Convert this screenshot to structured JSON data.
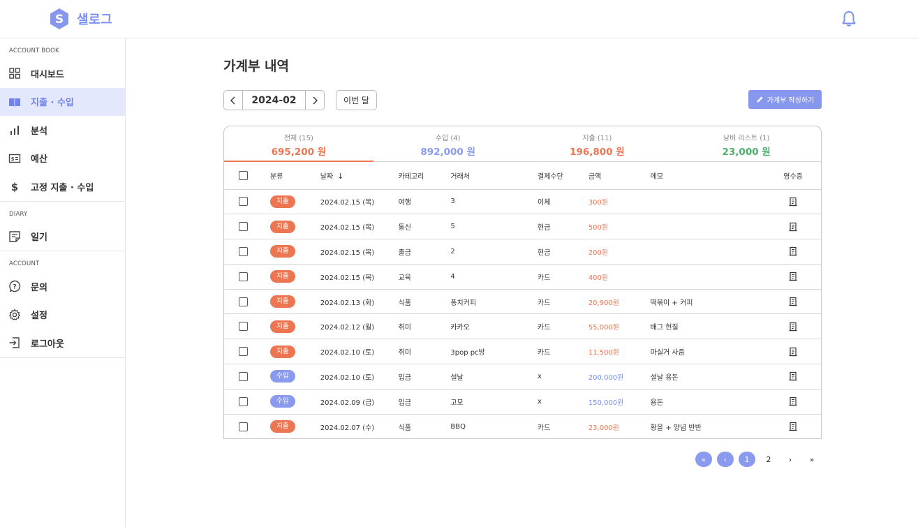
{
  "app": {
    "name": "샐로그",
    "logo_letter": "S"
  },
  "colors": {
    "accent": "#7b8ff0",
    "expense": "#ec7552",
    "income": "#8a9bef",
    "waste": "#4caf6a"
  },
  "sidebar": {
    "sections": [
      {
        "title": "ACCOUNT BOOK",
        "items": [
          {
            "label": "대시보드",
            "icon": "grid-icon"
          },
          {
            "label": "지출 · 수입",
            "icon": "book-icon",
            "active": true
          },
          {
            "label": "분석",
            "icon": "bar-chart-icon"
          },
          {
            "label": "예산",
            "icon": "wallet-icon"
          },
          {
            "label": "고정 지출 · 수입",
            "icon": "dollar-icon"
          }
        ]
      },
      {
        "title": "DIARY",
        "items": [
          {
            "label": "일기",
            "icon": "note-icon"
          }
        ]
      },
      {
        "title": "ACCOUNT",
        "items": [
          {
            "label": "문의",
            "icon": "question-icon"
          },
          {
            "label": "설정",
            "icon": "gear-icon"
          },
          {
            "label": "로그아웃",
            "icon": "logout-icon"
          }
        ]
      }
    ]
  },
  "main": {
    "title": "가계부 내역",
    "month": "2024-02",
    "this_month_label": "이번 달",
    "write_label": "가계부 작성하기",
    "summary": [
      {
        "label": "전체 (15)",
        "amount": "695,200 원",
        "color": "#ec7552",
        "active": true
      },
      {
        "label": "수입 (4)",
        "amount": "892,000 원",
        "color": "#8a9bef"
      },
      {
        "label": "지출 (11)",
        "amount": "196,800 원",
        "color": "#ec7552"
      },
      {
        "label": "낭비 리스트 (1)",
        "amount": "23,000 원",
        "color": "#4caf6a"
      }
    ],
    "columns": [
      "분류",
      "날짜",
      "카테고리",
      "거래처",
      "결제수단",
      "금액",
      "메모",
      "영수증"
    ],
    "rows": [
      {
        "type": "지출",
        "kind": "exp",
        "date": "2024.02.15 (목)",
        "category": "여행",
        "vendor": "3",
        "payment": "이체",
        "amount": "300원",
        "memo": ""
      },
      {
        "type": "지출",
        "kind": "exp",
        "date": "2024.02.15 (목)",
        "category": "통신",
        "vendor": "5",
        "payment": "현금",
        "amount": "500원",
        "memo": ""
      },
      {
        "type": "지출",
        "kind": "exp",
        "date": "2024.02.15 (목)",
        "category": "출금",
        "vendor": "2",
        "payment": "현금",
        "amount": "200원",
        "memo": ""
      },
      {
        "type": "지출",
        "kind": "exp",
        "date": "2024.02.15 (목)",
        "category": "교육",
        "vendor": "4",
        "payment": "카드",
        "amount": "400원",
        "memo": ""
      },
      {
        "type": "지출",
        "kind": "exp",
        "date": "2024.02.13 (화)",
        "category": "식품",
        "vendor": "퐁치커피",
        "payment": "카드",
        "amount": "20,900원",
        "memo": "떡볶이 + 커피"
      },
      {
        "type": "지출",
        "kind": "exp",
        "date": "2024.02.12 (월)",
        "category": "취미",
        "vendor": "카카오",
        "payment": "카드",
        "amount": "55,000원",
        "memo": "배그 현질"
      },
      {
        "type": "지출",
        "kind": "exp",
        "date": "2024.02.10 (토)",
        "category": "취미",
        "vendor": "3pop pc방",
        "payment": "카드",
        "amount": "11,500원",
        "memo": "마실거 사줌"
      },
      {
        "type": "수입",
        "kind": "inc",
        "date": "2024.02.10 (토)",
        "category": "입금",
        "vendor": "설날",
        "payment": "x",
        "amount": "200,000원",
        "memo": "설날 용돈"
      },
      {
        "type": "수입",
        "kind": "inc",
        "date": "2024.02.09 (금)",
        "category": "입금",
        "vendor": "고모",
        "payment": "x",
        "amount": "150,000원",
        "memo": "용돈"
      },
      {
        "type": "지출",
        "kind": "exp",
        "date": "2024.02.07 (수)",
        "category": "식품",
        "vendor": "BBQ",
        "payment": "카드",
        "amount": "23,000원",
        "memo": "황올 + 양념 반반"
      }
    ],
    "pagination": {
      "first": "«",
      "prev": "‹",
      "pages": [
        "1",
        "2"
      ],
      "current": "1",
      "next": "›",
      "last": "»"
    }
  }
}
